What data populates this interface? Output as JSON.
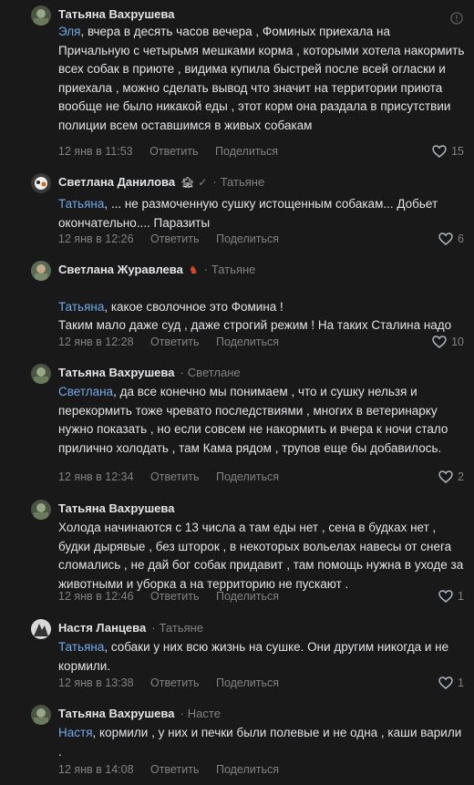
{
  "comments": [
    {
      "author": "Татьяна Вахрушева",
      "reply_to": "",
      "mention": "Эля",
      "text": ", вчера в десять часов вечера , Фоминых приехала на Причальную с четырьмя мешками корма , которыми хотела накормить всех собак в приюте , видима купила быстрей после всей огласки и приехала , можно сделать вывод что значит на территории приюта вообще не было никакой еды , этот корм она раздала в присутствии полиции всем оставшимся в живых собакам",
      "time": "12 янв в 11:53",
      "reply_label": "Ответить",
      "share_label": "Поделиться",
      "likes": "15"
    },
    {
      "author": "Светлана Данилова",
      "reply_to": "Татьяне",
      "mention": "Татьяна",
      "text": ", ... не размоченную сушку истощенным собакам... Добьет окончательно.... Паразиты",
      "time": "12 янв в 12:26",
      "reply_label": "Ответить",
      "share_label": "Поделиться",
      "likes": "6"
    },
    {
      "author": "Светлана Журавлева",
      "reply_to": "Татьяне",
      "mention": "Татьяна",
      "text": ", какое сволочное это Фомина !\nТаким мало даже суд , даже строгий режим ! На таких Сталина надо",
      "time": "12 янв в 12:28",
      "reply_label": "Ответить",
      "share_label": "Поделиться",
      "likes": "10"
    },
    {
      "author": "Татьяна Вахрушева",
      "reply_to": "Светлане",
      "mention": "Светлана",
      "text": ", да все конечно мы понимаем , что и сушку нельзя и перекормить тоже чревато последствиями , многих в ветеринарку нужно показать , но если совсем не накормить и вчера к ночи стало прилично холодать , там Кама рядом , трупов еще бы добавилось.",
      "time": "12 янв в 12:34",
      "reply_label": "Ответить",
      "share_label": "Поделиться",
      "likes": "2"
    },
    {
      "author": "Татьяна Вахрушева",
      "reply_to": "",
      "mention": "",
      "text": "Холода начинаются с 13 числа а там еды нет , сена в будках нет , будки дырявые , без шторок , в некоторых вольелах навесы от снега сломались , не дай бог собак придавит , там помощь нужна в уходе за животными и уборка а на территорию не пускают .",
      "time": "12 янв в 12:46",
      "reply_label": "Ответить",
      "share_label": "Поделиться",
      "likes": "1"
    },
    {
      "author": "Настя Ланцева",
      "reply_to": "Татьяне",
      "mention": "Татьяна",
      "text": ", собаки у них всю жизнь на сушке. Они другим никогда и не кормили.",
      "time": "12 янв в 13:38",
      "reply_label": "Ответить",
      "share_label": "Поделиться",
      "likes": "1"
    },
    {
      "author": "Татьяна Вахрушева",
      "reply_to": "Насте",
      "mention": "Настя",
      "text": ", кормили , у них и печки были полевые и не одна , каши варили .",
      "time": "12 янв в 14:08",
      "reply_label": "Ответить",
      "share_label": "Поделиться",
      "likes": ""
    }
  ],
  "colors": {
    "background": "#191919",
    "text": "#e1e3e6",
    "muted": "#828282",
    "mention": "#71aaeb"
  }
}
